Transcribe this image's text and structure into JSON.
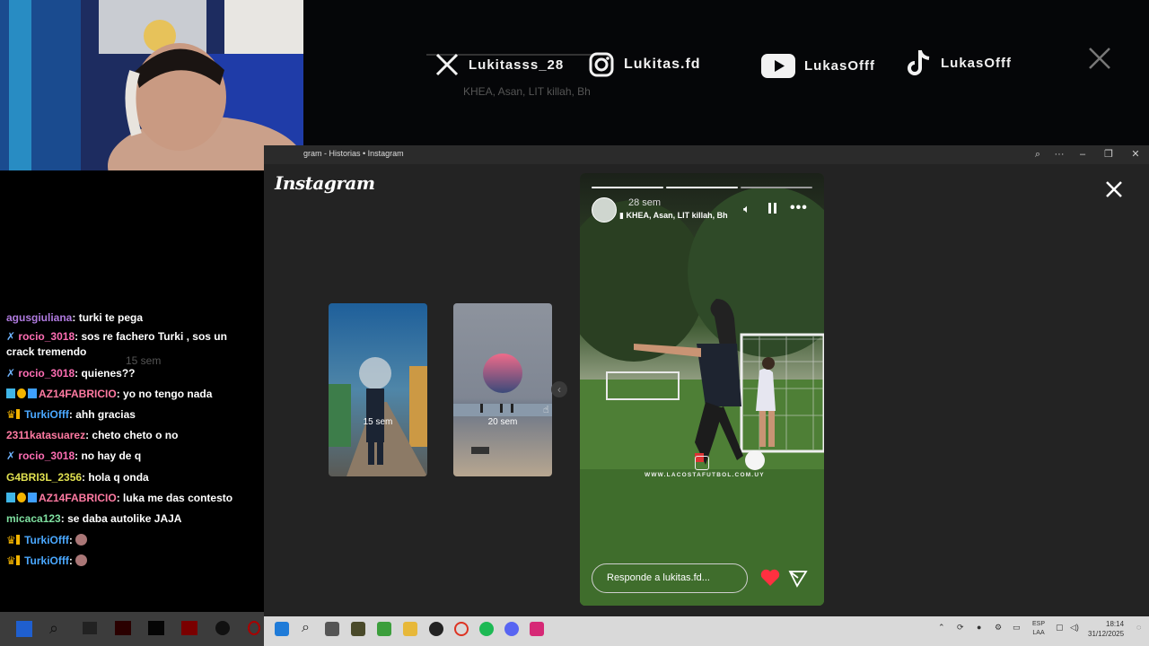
{
  "banner": {
    "socials": [
      {
        "icon": "x-icon",
        "handle": "Lukitasss_28"
      },
      {
        "icon": "instagram-icon",
        "handle": "Lukitas.fd"
      },
      {
        "icon": "youtube-icon",
        "handle": "LukasOfff"
      },
      {
        "icon": "tiktok-icon",
        "handle": "LukasOfff"
      }
    ],
    "ghost_music": "KHEA, Asan, LIT killah, Bh"
  },
  "chat": {
    "messages": [
      {
        "user": "agusgiuliana",
        "color": "#b07be0",
        "text": "turki te pega"
      },
      {
        "user": "rocio_3018",
        "color": "#ff6eb4",
        "text": "sos re fachero Turki , sos un crack tremendo"
      },
      {
        "user": "rocio_3018",
        "color": "#ff6eb4",
        "text": "quienes??"
      },
      {
        "user": "AZ14FABRICIO",
        "color": "#ff7aa2",
        "text": "yo no tengo nada"
      },
      {
        "user": "TurkiOfff",
        "color": "#4aa8ff",
        "text": "ahh gracias"
      },
      {
        "user": "2311katasuarez",
        "color": "#ff7aa2",
        "text": "cheto cheto o no"
      },
      {
        "user": "rocio_3018",
        "color": "#ff6eb4",
        "text": "no hay de q"
      },
      {
        "user": "G4BRI3L_2356",
        "color": "#e0e050",
        "text": "hola q onda"
      },
      {
        "user": "AZ14FABRICIO",
        "color": "#ff7aa2",
        "text": "luka me das contesto"
      },
      {
        "user": "micaca123",
        "color": "#7fe0a0",
        "text": "se daba autolike JAJA"
      },
      {
        "user": "TurkiOfff",
        "color": "#4aa8ff",
        "text": ""
      },
      {
        "user": "TurkiOfff",
        "color": "#4aa8ff",
        "text": ""
      }
    ],
    "ghost_age": "15 sem"
  },
  "window": {
    "title": "gram - Historias • Instagram",
    "logo": "Instagram"
  },
  "stories": {
    "thumbs": [
      {
        "age": "15 sem"
      },
      {
        "age": "20 sem"
      }
    ],
    "current": {
      "age": "28 sem",
      "music": "KHEA, Asan, LIT killah, Bh",
      "watermark": "WWW.LACOSTAFUTBOL.COM.UY",
      "reply_placeholder": "Responde a lukitas.fd...",
      "progress_segments": 3,
      "active_segment": 2
    }
  },
  "taskbar": {
    "lang": "ESP",
    "lang_sub": "LAA",
    "time": "18:14",
    "date": "31/12/2025"
  },
  "colors": {
    "accent_red": "#ff3040",
    "background": "#232323"
  }
}
